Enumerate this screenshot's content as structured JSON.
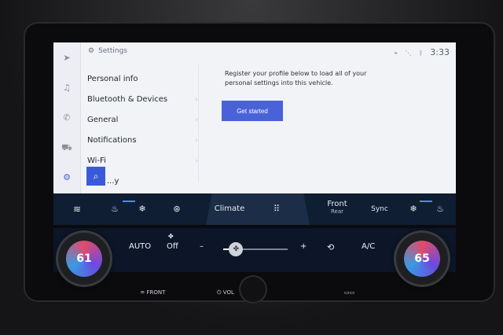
{
  "screen": {
    "settings_title": "Settings",
    "time": "3:33",
    "menu": [
      {
        "label": "Personal info"
      },
      {
        "label": "Bluetooth & Devices"
      },
      {
        "label": "General"
      },
      {
        "label": "Notifications"
      },
      {
        "label": "Wi-Fi"
      },
      {
        "label": "...y"
      }
    ],
    "register_text": "Register your profile below to load all of your personal settings into this vehicle.",
    "get_started": "Get started"
  },
  "hvac": {
    "climate": "Climate",
    "front": "Front",
    "rear": "Rear",
    "sync": "Sync",
    "auto": "AUTO",
    "off": "Off",
    "ac": "A/C",
    "minus": "–",
    "plus": "+",
    "left_temp": "61",
    "right_temp": "65",
    "fan_level": 0.2
  },
  "hardware": {
    "front_label": "FRONT",
    "vol_label": "VOL"
  },
  "icons": [
    "navigation-icon",
    "music-icon",
    "phone-icon",
    "car-icon",
    "gear-icon",
    "search-icon",
    "location-icon",
    "signal-icon",
    "bluetooth-icon",
    "fan-icon",
    "seat-heat-icon",
    "steering-heat-icon",
    "apps-grid-icon",
    "defrost-icon",
    "recirculation-icon"
  ]
}
